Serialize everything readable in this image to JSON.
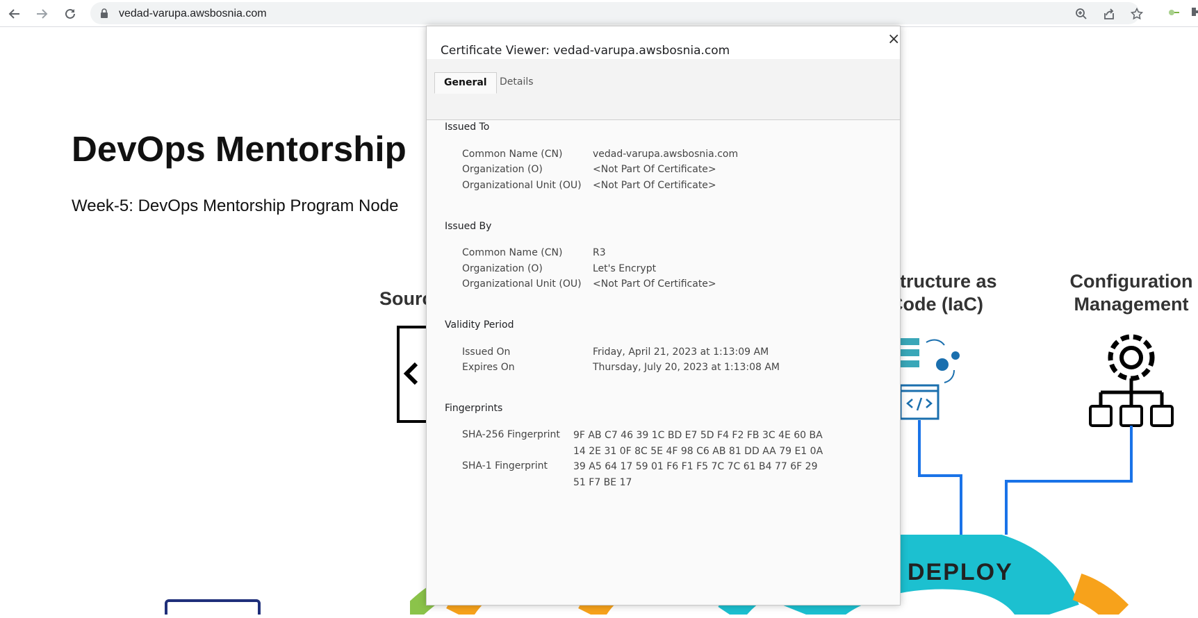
{
  "browser": {
    "url": "vedad-varupa.awsbosnia.com",
    "icons": [
      "back-icon",
      "forward-icon",
      "reload-icon",
      "lock-icon",
      "zoom-icon",
      "share-icon",
      "star-icon",
      "extension-icon",
      "puzzle-icon"
    ]
  },
  "page": {
    "title": "DevOps Mentorship",
    "subtitle": "Week-5: DevOps Mentorship Program Node",
    "stages": {
      "source": "Sourc",
      "iac_line1": "structure as",
      "iac_line2": "Code (IaC)",
      "config_line1": "Configuration",
      "config_line2": "Management",
      "deploy": "DEPLOY"
    },
    "colors": {
      "deploy_ring": "#1cc0d0",
      "pipeline_line": "#1a73e8",
      "orange": "#f7a21b"
    }
  },
  "dialog": {
    "title": "Certificate Viewer: vedad-varupa.awsbosnia.com",
    "close": "×",
    "tabs": [
      "General",
      "Details"
    ],
    "issued_to": {
      "heading": "Issued To",
      "rows": [
        {
          "label": "Common Name (CN)",
          "value": "vedad-varupa.awsbosnia.com"
        },
        {
          "label": "Organization (O)",
          "value": "<Not Part Of Certificate>"
        },
        {
          "label": "Organizational Unit (OU)",
          "value": "<Not Part Of Certificate>"
        }
      ]
    },
    "issued_by": {
      "heading": "Issued By",
      "rows": [
        {
          "label": "Common Name (CN)",
          "value": "R3"
        },
        {
          "label": "Organization (O)",
          "value": "Let's Encrypt"
        },
        {
          "label": "Organizational Unit (OU)",
          "value": "<Not Part Of Certificate>"
        }
      ]
    },
    "validity": {
      "heading": "Validity Period",
      "rows": [
        {
          "label": "Issued On",
          "value": "Friday, April 21, 2023 at 1:13:09 AM"
        },
        {
          "label": "Expires On",
          "value": "Thursday, July 20, 2023 at 1:13:08 AM"
        }
      ]
    },
    "fingerprints": {
      "heading": "Fingerprints",
      "sha256_label": "SHA-256 Fingerprint",
      "sha256_line1": "9F AB C7 46 39 1C BD E7 5D F4 F2 FB 3C 4E 60 BA",
      "sha256_line2": "14 2E 31 0F 8C 5E 4F 98 C6 AB 81 DD AA 79 E1 0A",
      "sha1_label": "SHA-1 Fingerprint",
      "sha1_line1": "39 A5 64 17 59 01 F6 F1 F5 7C 7C 61 B4 77 6F 29",
      "sha1_line2": "51 F7 BE 17"
    }
  }
}
